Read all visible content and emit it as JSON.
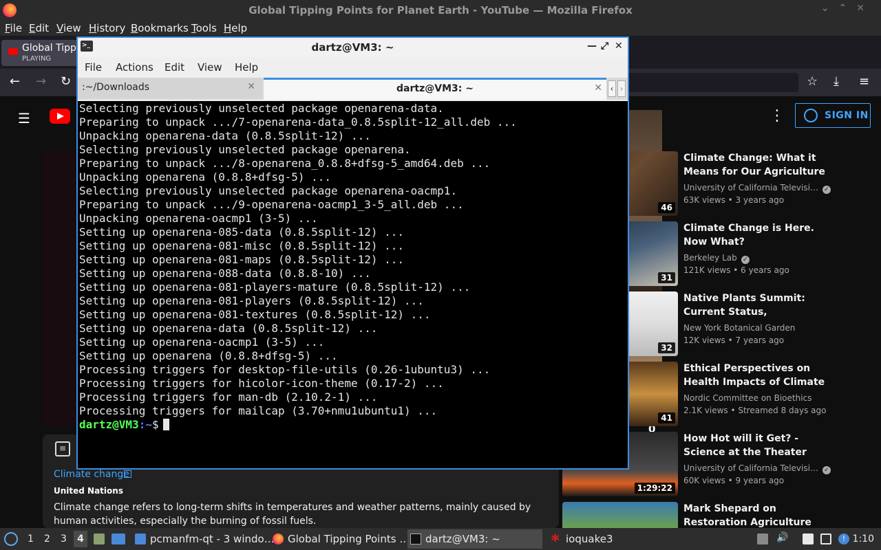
{
  "firefox": {
    "window_title": "Global Tipping Points for Planet Earth - YouTube — Mozilla Firefox",
    "menu": [
      "File",
      "Edit",
      "View",
      "History",
      "Bookmarks",
      "Tools",
      "Help"
    ],
    "tab": {
      "title": "Global Tippi",
      "status": "PLAYING"
    },
    "nav": {
      "back": "←",
      "forward": "→",
      "reload": "↻",
      "bookmark": "☆",
      "downloads": "⤓",
      "menu": "≡"
    }
  },
  "youtube": {
    "menu_icon": "☰",
    "more_icon": "⋮",
    "sign_in": "SIGN IN",
    "info_panel": {
      "link": "Climate change",
      "org": "United Nations",
      "description": "Climate change refers to long-term shifts in temperatures and weather patterns, mainly caused by human activities, especially the burning of fossil fuels."
    },
    "recommendations": [
      {
        "title": "Climate Change: What it Means for Our Agriculture and Our…",
        "channel": "University of California Televisi…",
        "verified": true,
        "meta": "63K views • 3 years ago",
        "duration": "46"
      },
      {
        "title": "Climate Change is Here. Now What?",
        "channel": "Berkeley Lab",
        "verified": true,
        "meta": "121K views • 6 years ago",
        "duration": "31"
      },
      {
        "title": "Native Plants Summit: Current Status, Conservation, and…",
        "channel": "New York Botanical Garden",
        "verified": false,
        "meta": "12K views • 7 years ago",
        "duration": "32"
      },
      {
        "title": "Ethical Perspectives on Health Impacts of Climate Change |…",
        "channel": "Nordic Committee on Bioethics",
        "verified": false,
        "meta": "2.1K views • Streamed 8 days ago",
        "duration": "41"
      },
      {
        "title": "How Hot will it Get? - Science at the Theater",
        "channel": "University of California Televisi…",
        "verified": true,
        "meta": "60K views • 9 years ago",
        "duration": "1:29:22"
      },
      {
        "title": "Mark Shepard on Restoration Agriculture",
        "channel": "",
        "verified": false,
        "meta": "",
        "duration": ""
      }
    ],
    "player_overlay_count": "0"
  },
  "terminal": {
    "window_title": "dartz@VM3: ~",
    "menu": [
      "File",
      "Actions",
      "Edit",
      "View",
      "Help"
    ],
    "tabs": [
      {
        "label": ":~/Downloads",
        "active": false
      },
      {
        "label": "dartz@VM3: ~",
        "active": true
      }
    ],
    "lines": [
      "Selecting previously unselected package openarena-data.",
      "Preparing to unpack .../7-openarena-data_0.8.5split-12_all.deb ...",
      "Unpacking openarena-data (0.8.5split-12) ...",
      "Selecting previously unselected package openarena.",
      "Preparing to unpack .../8-openarena_0.8.8+dfsg-5_amd64.deb ...",
      "Unpacking openarena (0.8.8+dfsg-5) ...",
      "Selecting previously unselected package openarena-oacmp1.",
      "Preparing to unpack .../9-openarena-oacmp1_3-5_all.deb ...",
      "Unpacking openarena-oacmp1 (3-5) ...",
      "Setting up openarena-085-data (0.8.5split-12) ...",
      "Setting up openarena-081-misc (0.8.5split-12) ...",
      "Setting up openarena-081-maps (0.8.5split-12) ...",
      "Setting up openarena-088-data (0.8.8-10) ...",
      "Setting up openarena-081-players-mature (0.8.5split-12) ...",
      "Setting up openarena-081-players (0.8.5split-12) ...",
      "Setting up openarena-081-textures (0.8.5split-12) ...",
      "Setting up openarena-data (0.8.5split-12) ...",
      "Setting up openarena-oacmp1 (3-5) ...",
      "Setting up openarena (0.8.8+dfsg-5) ...",
      "Processing triggers for desktop-file-utils (0.26-1ubuntu3) ...",
      "Processing triggers for hicolor-icon-theme (0.17-2) ...",
      "Processing triggers for man-db (2.10.2-1) ...",
      "Processing triggers for mailcap (3.70+nmu1ubuntu1) ..."
    ],
    "prompt_user": "dartz@VM3",
    "prompt_path": ":~",
    "prompt_symbol": "$"
  },
  "taskbar": {
    "workspaces": [
      "1",
      "2",
      "3",
      "4"
    ],
    "active_workspace": "4",
    "tasks": [
      {
        "label": "pcmanfm-qt - 3 windo…"
      },
      {
        "label": "Global Tipping Points …"
      },
      {
        "label": "dartz@VM3: ~"
      },
      {
        "label": "ioquake3"
      }
    ],
    "clock": "1:10"
  },
  "colors": {
    "terminal_bg": "#000000",
    "prompt_green": "#55ff55",
    "prompt_blue": "#5c78ff",
    "accent": "#3d8ee0",
    "youtube_red": "#ff0000",
    "link_blue": "#3ea6ff"
  }
}
